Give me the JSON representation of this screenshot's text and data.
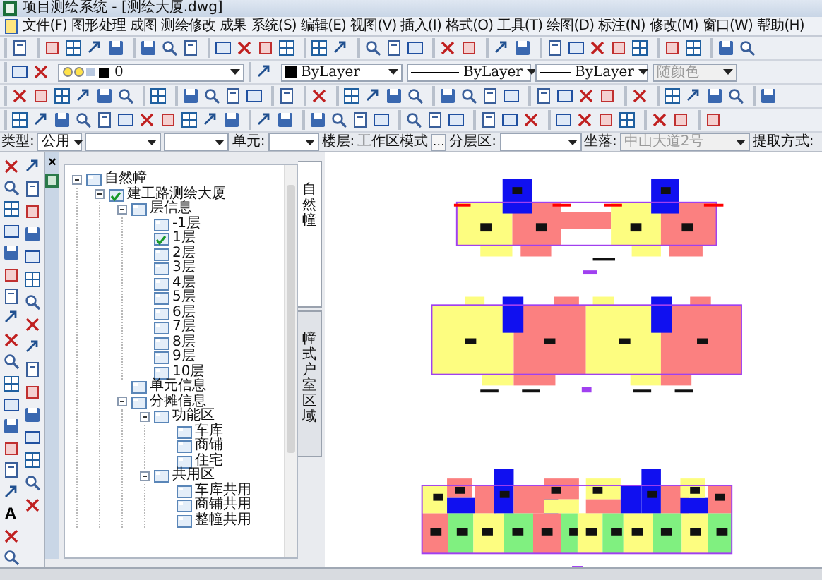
{
  "window": {
    "title": "项目测绘系统 - [测绘大厦.dwg]"
  },
  "menu": [
    "文件(F)",
    "图形处理",
    "成图",
    "测绘修改",
    "成果",
    "系统(S)",
    "编辑(E)",
    "视图(V)",
    "插入(I)",
    "格式(O)",
    "工具(T)",
    "绘图(D)",
    "标注(N)",
    "修改(M)",
    "窗口(W)",
    "帮助(H)"
  ],
  "layer_toolbar": {
    "layer": "0",
    "color_setting": "ByLayer",
    "linetype": "ByLayer",
    "lineweight": "ByLayer",
    "plot_style": {
      "value": "随颜色",
      "disabled": true
    }
  },
  "filter_bar": {
    "type_label": "类型:",
    "type_value": "公用",
    "unit_label": "单元:",
    "floor_label": "楼层:",
    "floor_value": "工作区模式",
    "floor_button": "…",
    "split_label": "分层区:",
    "location_label": "坐落:",
    "location": {
      "value": "中山大道2号",
      "disabled": true
    },
    "extract_label": "提取方式:"
  },
  "left_tools": {
    "text_tool": "A"
  },
  "panel": {
    "close": "×",
    "tabs": [
      {
        "label": "自然幢",
        "selected": true
      },
      {
        "label": "幢式户室区域",
        "selected": false
      }
    ],
    "tree": [
      {
        "label": "自然幢",
        "checked": false,
        "expanded": true,
        "children": [
          {
            "label": "建工路测绘大厦",
            "checked": true,
            "expanded": true,
            "children": [
              {
                "label": "层信息",
                "checked": false,
                "expanded": true,
                "children": [
                  {
                    "label": "-1层",
                    "checked": false
                  },
                  {
                    "label": "1层",
                    "checked": true
                  },
                  {
                    "label": "2层",
                    "checked": false
                  },
                  {
                    "label": "3层",
                    "checked": false
                  },
                  {
                    "label": "4层",
                    "checked": false
                  },
                  {
                    "label": "5层",
                    "checked": false
                  },
                  {
                    "label": "6层",
                    "checked": false
                  },
                  {
                    "label": "7层",
                    "checked": false
                  },
                  {
                    "label": "8层",
                    "checked": false
                  },
                  {
                    "label": "9层",
                    "checked": false
                  },
                  {
                    "label": "10层",
                    "checked": false
                  }
                ]
              },
              {
                "label": "单元信息",
                "checked": false
              },
              {
                "label": "分摊信息",
                "checked": false,
                "expanded": true,
                "children": [
                  {
                    "label": "功能区",
                    "checked": false,
                    "expanded": true,
                    "children": [
                      {
                        "label": "车库",
                        "checked": false
                      },
                      {
                        "label": "商铺",
                        "checked": false
                      },
                      {
                        "label": "住宅",
                        "checked": false
                      }
                    ]
                  },
                  {
                    "label": "共用区",
                    "checked": false,
                    "expanded": true,
                    "children": [
                      {
                        "label": "车库共用",
                        "checked": false
                      },
                      {
                        "label": "商铺共用",
                        "checked": false
                      },
                      {
                        "label": "整幢共用",
                        "checked": false
                      }
                    ]
                  }
                ]
              }
            ]
          }
        ]
      }
    ]
  }
}
